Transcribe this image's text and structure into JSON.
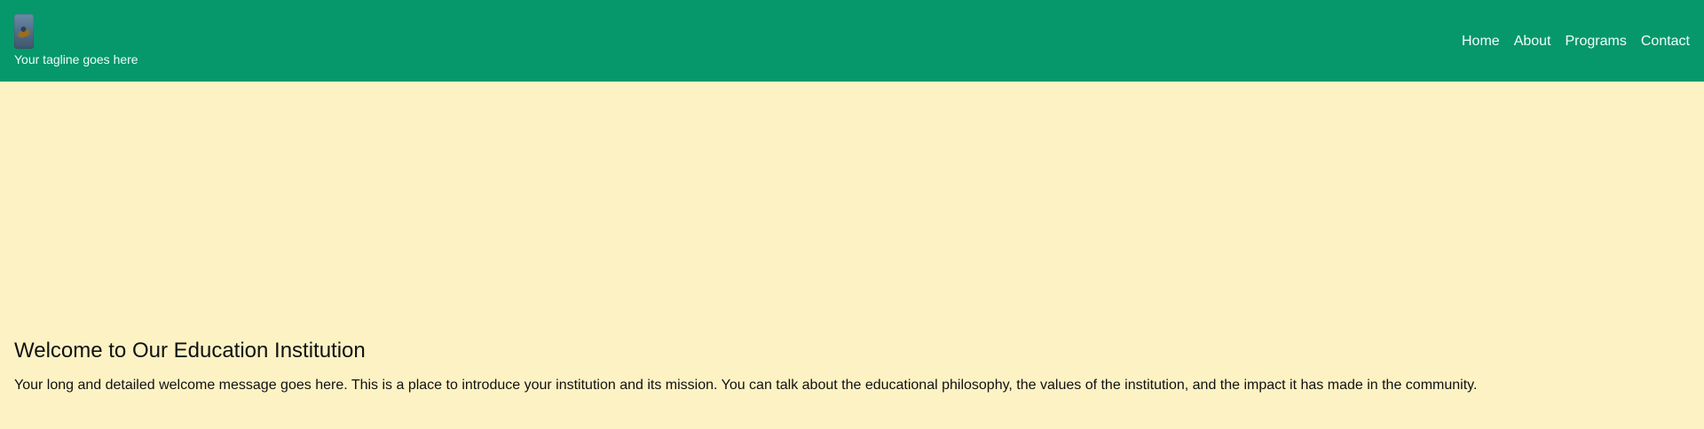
{
  "header": {
    "tagline": "Your tagline goes here",
    "nav": {
      "items": [
        {
          "label": "Home"
        },
        {
          "label": "About"
        },
        {
          "label": "Programs"
        },
        {
          "label": "Contact"
        }
      ]
    },
    "colors": {
      "header_bg": "#06976a",
      "page_bg": "#fdf2c4",
      "nav_text": "#f3fffb"
    },
    "logo_icon": "logo-icon"
  },
  "main": {
    "title": "Welcome to Our Education Institution",
    "message": "Your long and detailed welcome message goes here. This is a place to introduce your institution and its mission. You can talk about the educational philosophy, the values of the institution, and the impact it has made in the community."
  }
}
